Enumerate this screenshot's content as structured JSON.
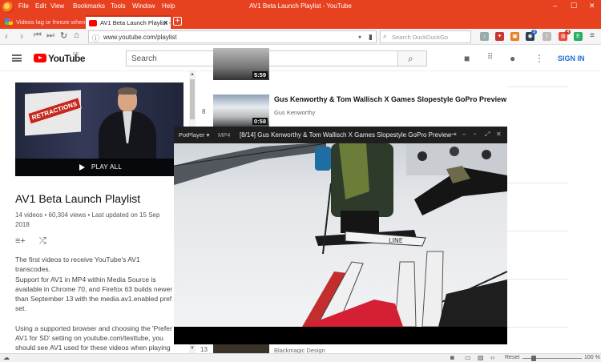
{
  "browser": {
    "window_title": "AV1 Beta Launch Playlist - YouTube",
    "menu": [
      "File",
      "Edit",
      "View",
      "Bookmarks",
      "Tools",
      "Window",
      "Help"
    ],
    "tabs": [
      {
        "label": "Videos lag or freeze when p",
        "active": false
      },
      {
        "label": "AV1 Beta Launch Playlist - Y",
        "active": true
      }
    ],
    "url": "www.youtube.com/playlist",
    "search_placeholder": "Search DuckDuckGo",
    "badges": [
      "3",
      "4"
    ]
  },
  "youtube": {
    "logo_text": "YouTube",
    "logo_region": "GB",
    "search_placeholder": "Search",
    "sign_in": "SIGN IN"
  },
  "playlist": {
    "play_all": "PLAY ALL",
    "retractions_label": "RETRACTIONS",
    "title": "AV1 Beta Launch Playlist",
    "videos": "14 videos",
    "views": "60,304 views",
    "updated": "Last updated on 15 Sep 2018",
    "description": [
      "The first videos to receive YouTube's AV1 transcodes.",
      "Support for AV1 in MP4 within Media Source is available in Chrome 70, and Firefox 63 builds newer than September 13 with the media.av1.enabled pref set.",
      "Using a supported browser and choosing the 'Prefer AV1 for SD' setting on youtube.com/testtube, you should see AV1 used for these videos when playing"
    ]
  },
  "list": [
    {
      "num": "",
      "duration": "5:59",
      "title": "",
      "channel": ""
    },
    {
      "num": "8",
      "duration": "0:58",
      "title": "Gus Kenworthy & Tom Wallisch X Games Slopestyle GoPro Preview",
      "channel": "Gus Kenworthy"
    },
    {
      "num": "13",
      "duration": "",
      "title": "",
      "channel": "Blackmagic Design"
    }
  ],
  "potplayer": {
    "app": "PotPlayer",
    "format": "MP4",
    "title": "[8/14] Gus Kenworthy & Tom Wallisch X Games Slopestyle GoPro Preview",
    "ski_brand": "LINE"
  },
  "statusbar": {
    "reset": "Reset",
    "zoom": "100 %"
  }
}
